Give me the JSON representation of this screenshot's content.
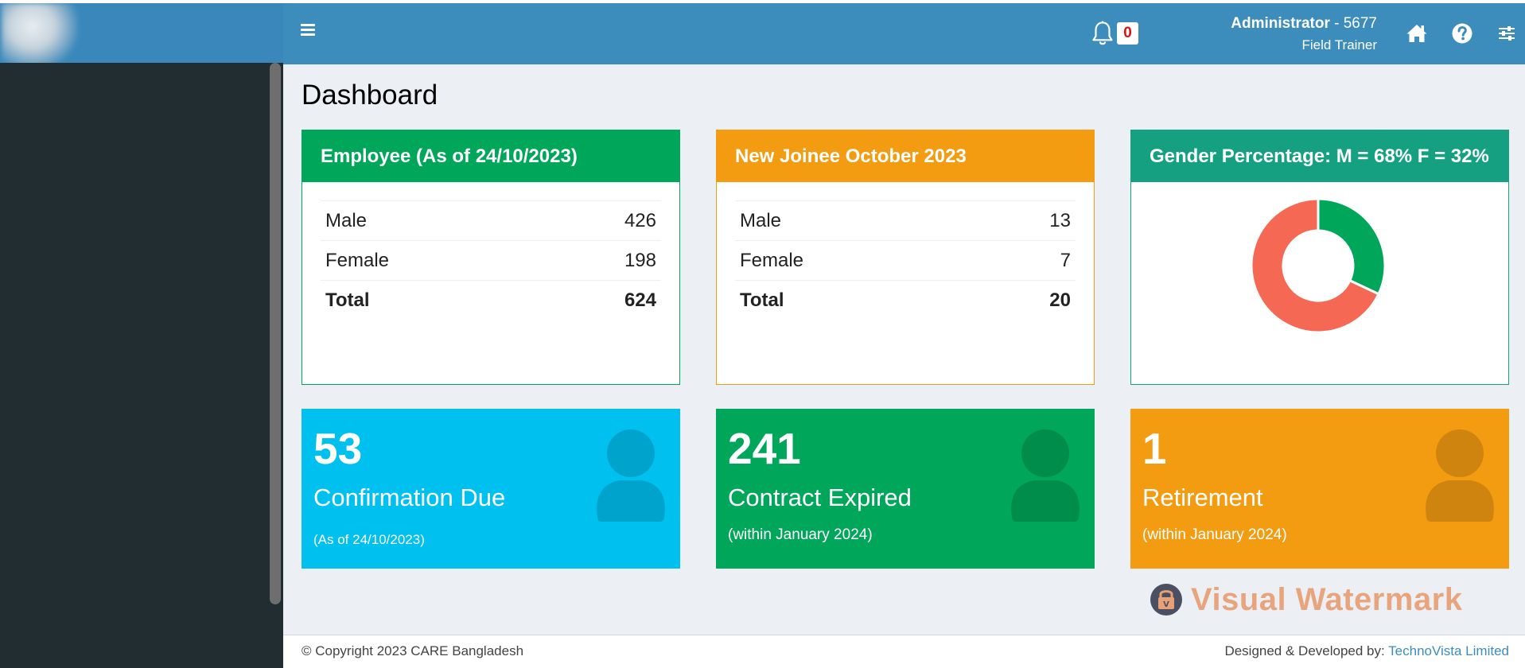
{
  "header": {
    "notification_count": "0",
    "user_name": "Administrator",
    "user_id": " - 5677",
    "user_role": "Field Trainer"
  },
  "page": {
    "title": "Dashboard"
  },
  "employee_card": {
    "title": "Employee (As of 24/10/2023)",
    "rows": [
      {
        "label": "Male",
        "value": "426"
      },
      {
        "label": "Female",
        "value": "198"
      },
      {
        "label": "Total",
        "value": "624"
      }
    ]
  },
  "joinee_card": {
    "title": "New Joinee October 2023",
    "rows": [
      {
        "label": "Male",
        "value": "13"
      },
      {
        "label": "Female",
        "value": "7"
      },
      {
        "label": "Total",
        "value": "20"
      }
    ]
  },
  "gender_card": {
    "title": "Gender Percentage: M = 68% F = 32%",
    "chart_data": {
      "type": "pie",
      "categories": [
        "M",
        "F"
      ],
      "values": [
        68,
        32
      ],
      "colors": [
        "#f56954",
        "#00a65a"
      ]
    }
  },
  "stat_boxes": [
    {
      "number": "53",
      "label": "Confirmation Due",
      "sub": "(As of 24/10/2023)",
      "color": "#00c0ef",
      "icon": "person-icon"
    },
    {
      "number": "241",
      "label": "Contract Expired",
      "sub": "(within January 2024)",
      "color": "#00a65a",
      "icon": "person-icon"
    },
    {
      "number": "1",
      "label": "Retirement",
      "sub": "(within January 2024)",
      "color": "#f39c12",
      "icon": "person-icon"
    }
  ],
  "watermark": {
    "text": "Visual Watermark"
  },
  "footer": {
    "copyright": "© Copyright 2023 CARE Bangladesh",
    "designed_by": "Designed & Developed by: ",
    "developer": "TechnoVista Limited"
  },
  "colors": {
    "navbar": "#3c8dbc",
    "sidebar": "#222d32",
    "green": "#00a65a",
    "orange": "#f39c12",
    "teal": "#16a082",
    "aqua": "#00c0ef",
    "red": "#f56954"
  }
}
